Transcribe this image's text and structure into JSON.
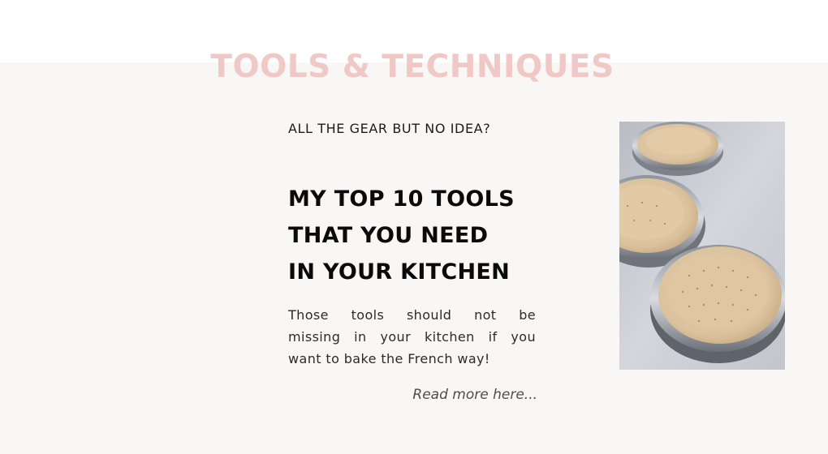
{
  "section": {
    "title": "TOOLS & TECHNIQUES",
    "title_color": "#f0c8c6",
    "background": "#f9f7f6"
  },
  "article": {
    "eyebrow": "ALL THE GEAR BUT NO IDEA?",
    "heading_lines": [
      "MY TOP 10 TOOLS",
      "THAT YOU NEED",
      "IN YOUR KITCHEN"
    ],
    "text_lines": [
      "Those tools should not be",
      "missing in your kitchen if you",
      "want to bake the French way!"
    ],
    "read_more": "Read more here..."
  },
  "image": {
    "icon": "tart-rings-photo",
    "subject": "pastry in tart rings"
  }
}
